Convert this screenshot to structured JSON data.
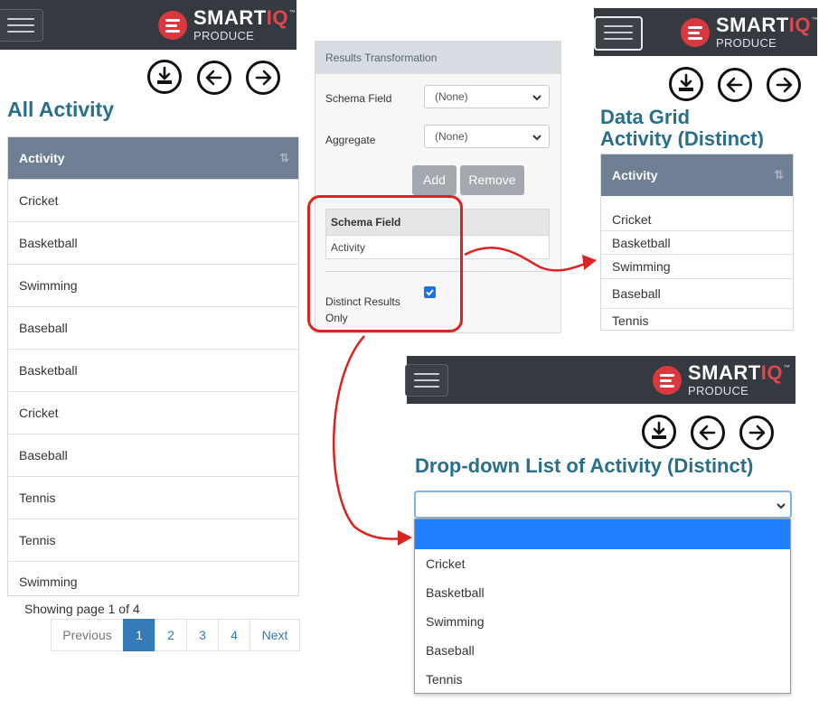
{
  "brand": {
    "name_main": "SMART",
    "name_accent": "IQ",
    "tm": "™",
    "sub": "PRODUCE",
    "accent_color": "#e0464d",
    "bar_color": "#343a40"
  },
  "left": {
    "title": "All Activity",
    "grid": {
      "header": "Activity",
      "sort_icon": "⇅",
      "rows": [
        "Cricket",
        "Basketball",
        "Swimming",
        "Baseball",
        "Basketball",
        "Cricket",
        "Baseball",
        "Tennis",
        "Tennis",
        "Swimming"
      ]
    },
    "paging": {
      "status": "Showing page 1 of 4",
      "previous": "Previous",
      "pages": [
        "1",
        "2",
        "3",
        "4"
      ],
      "next": "Next",
      "active_page": "1"
    }
  },
  "panel": {
    "title": "Results Transformation",
    "schema_field_label": "Schema Field",
    "schema_field_value": "(None)",
    "aggregate_label": "Aggregate",
    "aggregate_value": "(None)",
    "add_label": "Add",
    "remove_label": "Remove",
    "table_header": "Schema Field",
    "table_row": "Activity",
    "distinct_label_line1": "Distinct Results",
    "distinct_label_line2": "Only",
    "distinct_checked": true
  },
  "right": {
    "title_line1": "Data Grid",
    "title_line2": "Activity (Distinct)",
    "grid": {
      "header": "Activity",
      "sort_icon": "⇅",
      "rows": [
        "Cricket",
        "Basketball",
        "Swimming",
        "Baseball",
        "Tennis"
      ]
    }
  },
  "bottom": {
    "title": "Drop-down List of Activity (Distinct)",
    "select_value": "",
    "options": [
      "",
      "Cricket",
      "Basketball",
      "Swimming",
      "Baseball",
      "Tennis"
    ],
    "highlight_color": "#1e80ff"
  },
  "icons": [
    "hamburger-icon",
    "download-icon",
    "arrow-left-icon",
    "arrow-right-icon",
    "chevron-down-icon",
    "checkbox-icon"
  ]
}
